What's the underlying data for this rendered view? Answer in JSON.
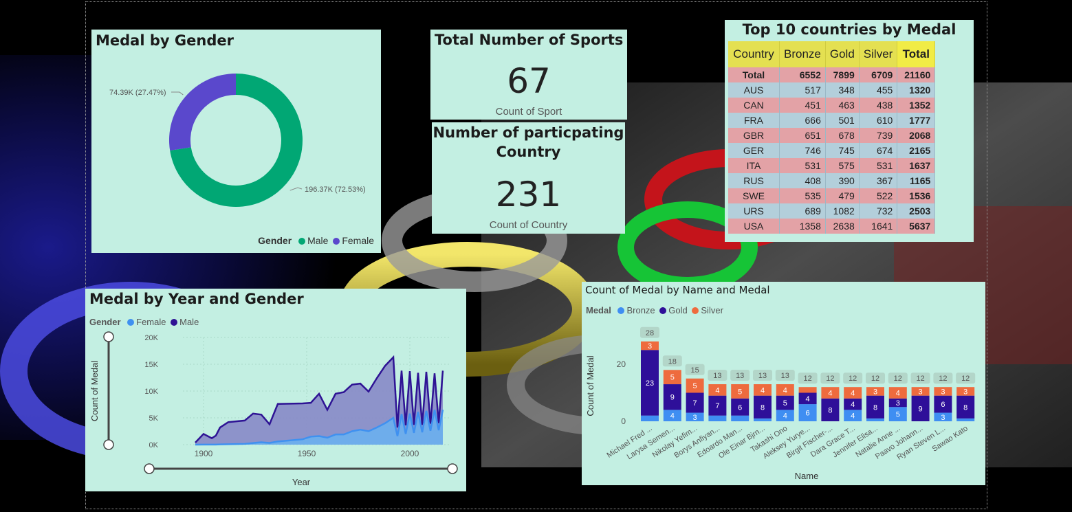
{
  "colors": {
    "male_donut": "#01a774",
    "female_donut": "#5a48cc",
    "line_male": "#2e1394",
    "line_female": "#3f91f0",
    "bronze": "#3f8ef2",
    "gold": "#2e0f99",
    "silver": "#ee6b3e",
    "card_bg": "#c3efe2"
  },
  "donut_card": {
    "title": "Medal by Gender",
    "legend_title": "Gender",
    "legend_items": [
      "Male",
      "Female"
    ]
  },
  "sports_card": {
    "title": "Total Number of Sports",
    "value": "67",
    "caption": "Count of Sport"
  },
  "country_card": {
    "title_line1": "Number of particpating",
    "title_line2": "Country",
    "value": "231",
    "caption": "Count of Country"
  },
  "table_card": {
    "title": "Top 10 countries by Medal",
    "headers": [
      "Country",
      "Bronze",
      "Gold",
      "Silver",
      "Total"
    ],
    "total_row": [
      "Total",
      "6552",
      "7899",
      "6709",
      "21160"
    ],
    "rows": [
      [
        "AUS",
        "517",
        "348",
        "455",
        "1320"
      ],
      [
        "CAN",
        "451",
        "463",
        "438",
        "1352"
      ],
      [
        "FRA",
        "666",
        "501",
        "610",
        "1777"
      ],
      [
        "GBR",
        "651",
        "678",
        "739",
        "2068"
      ],
      [
        "GER",
        "746",
        "745",
        "674",
        "2165"
      ],
      [
        "ITA",
        "531",
        "575",
        "531",
        "1637"
      ],
      [
        "RUS",
        "408",
        "390",
        "367",
        "1165"
      ],
      [
        "SWE",
        "535",
        "479",
        "522",
        "1536"
      ],
      [
        "URS",
        "689",
        "1082",
        "732",
        "2503"
      ],
      [
        "USA",
        "1358",
        "2638",
        "1641",
        "5637"
      ]
    ]
  },
  "line_card": {
    "title": "Medal by Year and Gender",
    "legend_title": "Gender",
    "legend_items": [
      "Female",
      "Male"
    ]
  },
  "bar_card": {
    "title": "Count of Medal by Name and Medal",
    "legend_title": "Medal",
    "legend_items": [
      "Bronze",
      "Gold",
      "Silver"
    ]
  },
  "chart_data": [
    {
      "type": "pie",
      "title": "Medal by Gender",
      "categories": [
        "Male",
        "Female"
      ],
      "values": [
        196370,
        74390
      ],
      "data_labels": [
        "196.37K (72.53%)",
        "74.39K (27.47%)"
      ],
      "legend": "bottom-right"
    },
    {
      "type": "area",
      "title": "Medal by Year and Gender",
      "xlabel": "Year",
      "ylabel": "Count of Medal",
      "xlim": [
        1890,
        2020
      ],
      "ylim": [
        0,
        20000
      ],
      "x_ticks": [
        "1900",
        "1950",
        "2000"
      ],
      "y_ticks": [
        "0K",
        "5K",
        "10K",
        "15K",
        "20K"
      ],
      "series": [
        {
          "name": "Male",
          "x": [
            1896,
            1900,
            1904,
            1906,
            1908,
            1912,
            1920,
            1924,
            1928,
            1932,
            1936,
            1948,
            1952,
            1956,
            1960,
            1964,
            1968,
            1972,
            1976,
            1980,
            1984,
            1988,
            1992,
            1994,
            1996,
            1998,
            2000,
            2002,
            2004,
            2006,
            2008,
            2010,
            2012,
            2014,
            2016
          ],
          "values": [
            380,
            2000,
            1200,
            1700,
            3200,
            4200,
            4500,
            5800,
            5600,
            3800,
            7600,
            7700,
            7800,
            9500,
            6500,
            9500,
            9800,
            11200,
            11400,
            9900,
            12400,
            14700,
            16300,
            3200,
            13800,
            3600,
            13700,
            3700,
            13400,
            3700,
            13600,
            3900,
            13300,
            4000,
            13800
          ]
        },
        {
          "name": "Female",
          "x": [
            1896,
            1900,
            1904,
            1906,
            1908,
            1912,
            1920,
            1924,
            1928,
            1932,
            1936,
            1948,
            1952,
            1956,
            1960,
            1964,
            1968,
            1972,
            1976,
            1980,
            1984,
            1988,
            1992,
            1994,
            1996,
            1998,
            2000,
            2002,
            2004,
            2006,
            2008,
            2010,
            2012,
            2014,
            2016
          ],
          "values": [
            0,
            20,
            10,
            10,
            50,
            80,
            150,
            300,
            450,
            320,
            600,
            1000,
            1500,
            1600,
            1300,
            1900,
            1900,
            2500,
            2800,
            2500,
            3200,
            4000,
            5000,
            1600,
            5700,
            2000,
            5800,
            2200,
            6100,
            2300,
            6300,
            2600,
            6500,
            2700,
            6500
          ]
        }
      ]
    },
    {
      "type": "bar",
      "stacked": true,
      "title": "Count of Medal by Name and Medal",
      "xlabel": "Name",
      "ylabel": "Count of Medal",
      "ylim": [
        0,
        30
      ],
      "y_ticks": [
        "0",
        "20"
      ],
      "categories": [
        "Michael Fred ...",
        "Larysa Semen...",
        "Nikolay Yefim...",
        "Borys Anfiyan...",
        "Edoardo Man...",
        "Ole Einar Bjrn...",
        "Takashi Ono",
        "Aleksey Yurye...",
        "Birgit Fischer-...",
        "Dara Grace T...",
        "Jennifer Elisa...",
        "Natalie Anne ...",
        "Paavo Johann...",
        "Ryan Steven L...",
        "Sawao Kato"
      ],
      "series": [
        {
          "name": "Bronze",
          "values": [
            2,
            4,
            3,
            2,
            2,
            1,
            4,
            6,
            0,
            4,
            1,
            5,
            0,
            3,
            1
          ]
        },
        {
          "name": "Gold",
          "values": [
            23,
            9,
            7,
            7,
            6,
            8,
            5,
            4,
            8,
            4,
            8,
            3,
            9,
            6,
            8
          ]
        },
        {
          "name": "Silver",
          "values": [
            3,
            5,
            5,
            4,
            5,
            4,
            4,
            2,
            4,
            4,
            3,
            4,
            3,
            3,
            3
          ]
        }
      ],
      "segment_labels": {
        "Bronze": [
          "",
          "4",
          "3",
          "",
          "",
          "",
          "4",
          "6",
          "",
          "4",
          "",
          "5",
          "",
          "3",
          ""
        ],
        "Gold": [
          "23",
          "9",
          "7",
          "7",
          "6",
          "8",
          "5",
          "4",
          "8",
          "4",
          "8",
          "3",
          "9",
          "6",
          "8"
        ],
        "Silver": [
          "3",
          "5",
          "5",
          "4",
          "5",
          "4",
          "4",
          "",
          "4",
          "4",
          "3",
          "4",
          "3",
          "3",
          "3"
        ]
      },
      "totals": [
        "28",
        "18",
        "15",
        "13",
        "13",
        "13",
        "13",
        "12",
        "12",
        "12",
        "12",
        "12",
        "12",
        "12",
        "12"
      ],
      "legend": "top-left"
    }
  ]
}
